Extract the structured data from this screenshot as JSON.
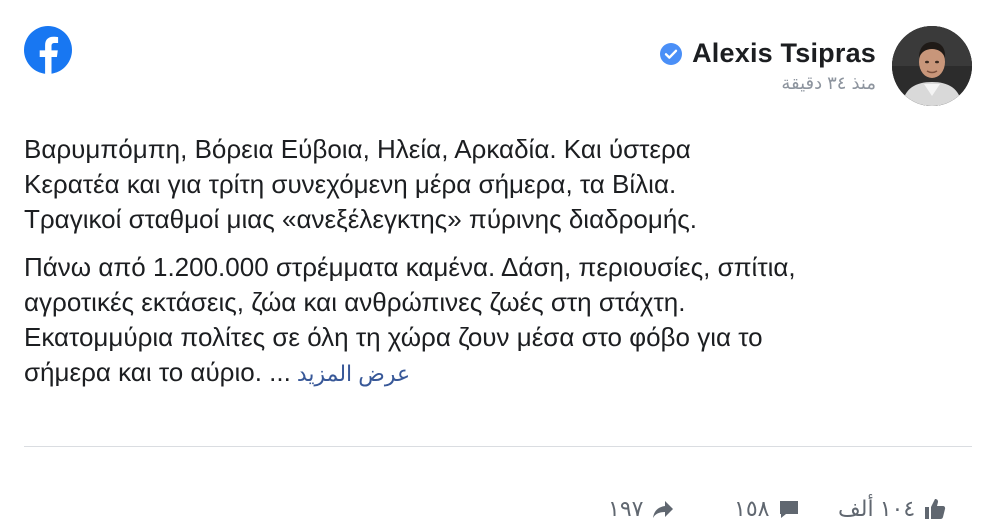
{
  "brand": {
    "icon": "facebook-logo-icon",
    "color": "#1877f2"
  },
  "author": {
    "name": "Alexis Tsipras",
    "verified": true,
    "verified_icon": "verified-badge-icon",
    "timestamp": "منذ ٣٤ دقيقة",
    "avatar": "profile-photo"
  },
  "post": {
    "paragraph1": [
      "Βαρυμπόμπη, Βόρεια Εύβοια, Ηλεία, Αρκαδία. Και ύστερα",
      "Κερατέα και για τρίτη συνεχόμενη μέρα σήμερα, τα Βίλια.",
      "Τραγικοί σταθμοί μιας «ανεξέλεγκτης» πύρινης διαδρομής."
    ],
    "paragraph2": [
      "Πάνω από 1.200.000 στρέμματα καμένα. Δάση, περιουσίες, σπίτια,",
      "αγροτικές εκτάσεις, ζώα και ανθρώπινες ζωές στη στάχτη.",
      "Εκατομμύρια πολίτες σε όλη τη χώρα ζουν μέσα στο φόβο για το",
      "σήμερα και το αύριο.  ..."
    ],
    "see_more": "عرض المزيد"
  },
  "footer": {
    "shares": "١٩٧",
    "share_icon": "share-arrow-icon",
    "comments": "١٥٨",
    "comment_icon": "comment-icon",
    "likes": "١٠٤ ألف",
    "like_icon": "like-thumb-icon"
  }
}
